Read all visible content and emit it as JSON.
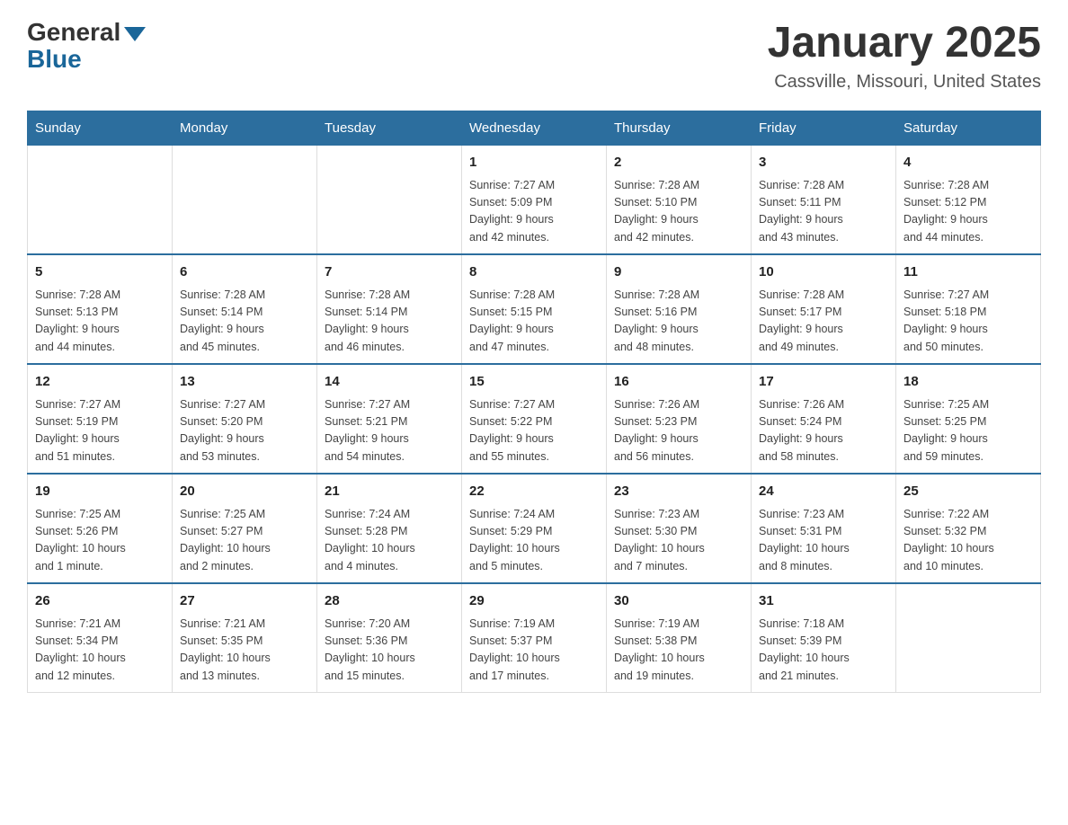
{
  "header": {
    "logo_general": "General",
    "logo_blue": "Blue",
    "month_title": "January 2025",
    "location": "Cassville, Missouri, United States"
  },
  "days_of_week": [
    "Sunday",
    "Monday",
    "Tuesday",
    "Wednesday",
    "Thursday",
    "Friday",
    "Saturday"
  ],
  "weeks": [
    [
      {
        "day": "",
        "info": ""
      },
      {
        "day": "",
        "info": ""
      },
      {
        "day": "",
        "info": ""
      },
      {
        "day": "1",
        "info": "Sunrise: 7:27 AM\nSunset: 5:09 PM\nDaylight: 9 hours\nand 42 minutes."
      },
      {
        "day": "2",
        "info": "Sunrise: 7:28 AM\nSunset: 5:10 PM\nDaylight: 9 hours\nand 42 minutes."
      },
      {
        "day": "3",
        "info": "Sunrise: 7:28 AM\nSunset: 5:11 PM\nDaylight: 9 hours\nand 43 minutes."
      },
      {
        "day": "4",
        "info": "Sunrise: 7:28 AM\nSunset: 5:12 PM\nDaylight: 9 hours\nand 44 minutes."
      }
    ],
    [
      {
        "day": "5",
        "info": "Sunrise: 7:28 AM\nSunset: 5:13 PM\nDaylight: 9 hours\nand 44 minutes."
      },
      {
        "day": "6",
        "info": "Sunrise: 7:28 AM\nSunset: 5:14 PM\nDaylight: 9 hours\nand 45 minutes."
      },
      {
        "day": "7",
        "info": "Sunrise: 7:28 AM\nSunset: 5:14 PM\nDaylight: 9 hours\nand 46 minutes."
      },
      {
        "day": "8",
        "info": "Sunrise: 7:28 AM\nSunset: 5:15 PM\nDaylight: 9 hours\nand 47 minutes."
      },
      {
        "day": "9",
        "info": "Sunrise: 7:28 AM\nSunset: 5:16 PM\nDaylight: 9 hours\nand 48 minutes."
      },
      {
        "day": "10",
        "info": "Sunrise: 7:28 AM\nSunset: 5:17 PM\nDaylight: 9 hours\nand 49 minutes."
      },
      {
        "day": "11",
        "info": "Sunrise: 7:27 AM\nSunset: 5:18 PM\nDaylight: 9 hours\nand 50 minutes."
      }
    ],
    [
      {
        "day": "12",
        "info": "Sunrise: 7:27 AM\nSunset: 5:19 PM\nDaylight: 9 hours\nand 51 minutes."
      },
      {
        "day": "13",
        "info": "Sunrise: 7:27 AM\nSunset: 5:20 PM\nDaylight: 9 hours\nand 53 minutes."
      },
      {
        "day": "14",
        "info": "Sunrise: 7:27 AM\nSunset: 5:21 PM\nDaylight: 9 hours\nand 54 minutes."
      },
      {
        "day": "15",
        "info": "Sunrise: 7:27 AM\nSunset: 5:22 PM\nDaylight: 9 hours\nand 55 minutes."
      },
      {
        "day": "16",
        "info": "Sunrise: 7:26 AM\nSunset: 5:23 PM\nDaylight: 9 hours\nand 56 minutes."
      },
      {
        "day": "17",
        "info": "Sunrise: 7:26 AM\nSunset: 5:24 PM\nDaylight: 9 hours\nand 58 minutes."
      },
      {
        "day": "18",
        "info": "Sunrise: 7:25 AM\nSunset: 5:25 PM\nDaylight: 9 hours\nand 59 minutes."
      }
    ],
    [
      {
        "day": "19",
        "info": "Sunrise: 7:25 AM\nSunset: 5:26 PM\nDaylight: 10 hours\nand 1 minute."
      },
      {
        "day": "20",
        "info": "Sunrise: 7:25 AM\nSunset: 5:27 PM\nDaylight: 10 hours\nand 2 minutes."
      },
      {
        "day": "21",
        "info": "Sunrise: 7:24 AM\nSunset: 5:28 PM\nDaylight: 10 hours\nand 4 minutes."
      },
      {
        "day": "22",
        "info": "Sunrise: 7:24 AM\nSunset: 5:29 PM\nDaylight: 10 hours\nand 5 minutes."
      },
      {
        "day": "23",
        "info": "Sunrise: 7:23 AM\nSunset: 5:30 PM\nDaylight: 10 hours\nand 7 minutes."
      },
      {
        "day": "24",
        "info": "Sunrise: 7:23 AM\nSunset: 5:31 PM\nDaylight: 10 hours\nand 8 minutes."
      },
      {
        "day": "25",
        "info": "Sunrise: 7:22 AM\nSunset: 5:32 PM\nDaylight: 10 hours\nand 10 minutes."
      }
    ],
    [
      {
        "day": "26",
        "info": "Sunrise: 7:21 AM\nSunset: 5:34 PM\nDaylight: 10 hours\nand 12 minutes."
      },
      {
        "day": "27",
        "info": "Sunrise: 7:21 AM\nSunset: 5:35 PM\nDaylight: 10 hours\nand 13 minutes."
      },
      {
        "day": "28",
        "info": "Sunrise: 7:20 AM\nSunset: 5:36 PM\nDaylight: 10 hours\nand 15 minutes."
      },
      {
        "day": "29",
        "info": "Sunrise: 7:19 AM\nSunset: 5:37 PM\nDaylight: 10 hours\nand 17 minutes."
      },
      {
        "day": "30",
        "info": "Sunrise: 7:19 AM\nSunset: 5:38 PM\nDaylight: 10 hours\nand 19 minutes."
      },
      {
        "day": "31",
        "info": "Sunrise: 7:18 AM\nSunset: 5:39 PM\nDaylight: 10 hours\nand 21 minutes."
      },
      {
        "day": "",
        "info": ""
      }
    ]
  ]
}
